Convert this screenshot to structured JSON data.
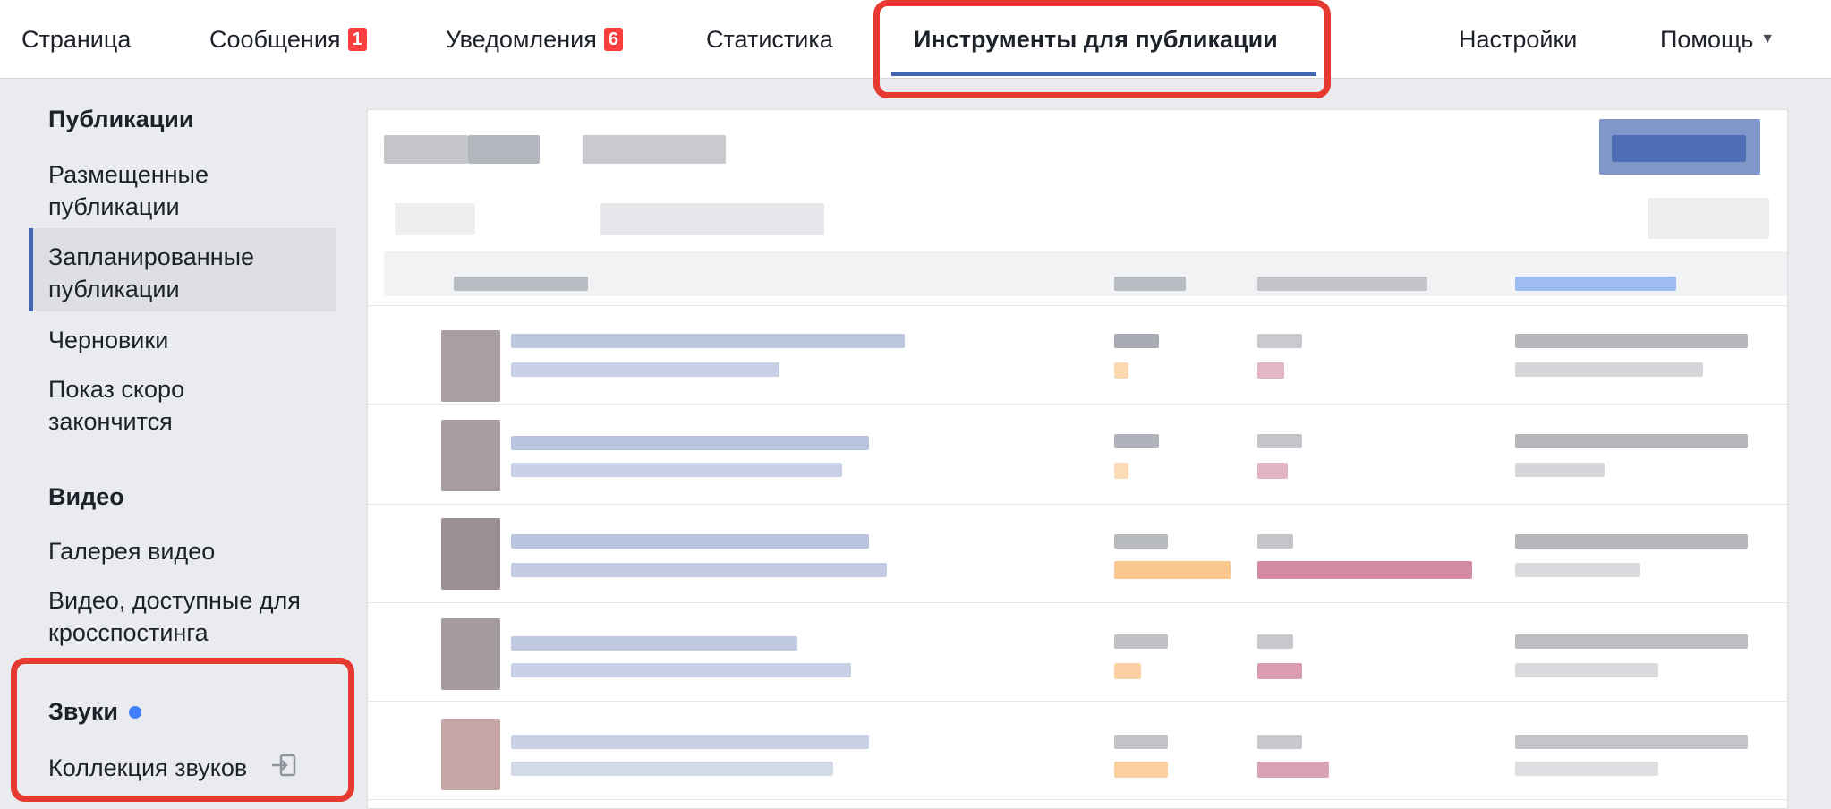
{
  "nav": {
    "tabs": [
      {
        "label": "Страница"
      },
      {
        "label": "Сообщения",
        "badge": "1"
      },
      {
        "label": "Уведомления",
        "badge": "6"
      },
      {
        "label": "Статистика"
      },
      {
        "label": "Инструменты для публикации",
        "active": true
      },
      {
        "label": "Настройки"
      },
      {
        "label": "Помощь",
        "icon": "caret-down-icon"
      }
    ]
  },
  "sidebar": {
    "publications": {
      "title": "Публикации",
      "items": [
        {
          "label": "Размещенные публикации",
          "selected": true
        },
        {
          "label": "Запланированные публикации"
        },
        {
          "label": "Черновики"
        },
        {
          "label": "Показ скоро закончится"
        }
      ]
    },
    "video": {
      "title": "Видео",
      "items": [
        {
          "label": "Галерея видео"
        },
        {
          "label": "Видео, доступные для кросспостинга"
        }
      ]
    },
    "sounds": {
      "title": "Звуки",
      "title_indicator": "dot-icon",
      "items": [
        {
          "label": "Коллекция звуков",
          "icon": "external-link-icon"
        }
      ]
    }
  },
  "colors": {
    "accent": "#4267b2",
    "badge": "#fa3e3e",
    "highlight": "#e43a2f",
    "new_dot": "#4080ff",
    "background": "#e9ebee"
  },
  "main_panel": {
    "content_state": "blurred"
  }
}
